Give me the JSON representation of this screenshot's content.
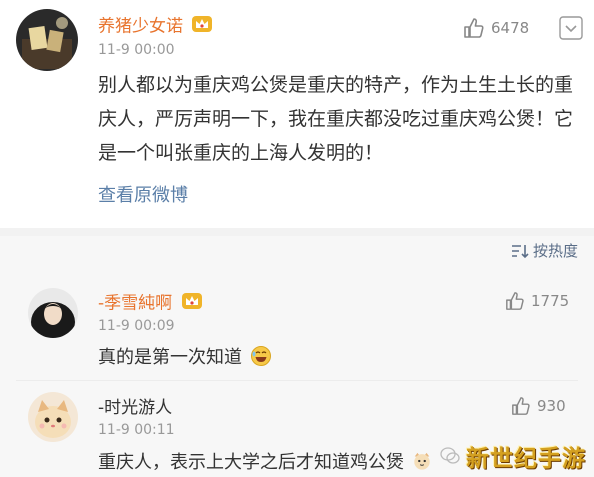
{
  "post": {
    "username": "养猪少女诺",
    "timestamp": "11-9 00:00",
    "likes": "6478",
    "text": "别人都以为重庆鸡公煲是重庆的特产，作为土生土长的重庆人，严厉声明一下，我在重庆都没吃过重庆鸡公煲！它是一个叫张重庆的上海人发明的！",
    "view_original": "查看原微博",
    "username_color": "#e8742e"
  },
  "sort": {
    "label": "按热度"
  },
  "comments": [
    {
      "username": "-季雪純啊",
      "timestamp": "11-9 00:09",
      "likes": "1775",
      "text": "真的是第一次知道",
      "emoji": "laughing-face-icon"
    },
    {
      "username": "-时光游人",
      "timestamp": "11-9 00:11",
      "likes": "930",
      "text": "重庆人，表示上大学之后才知道鸡公煲",
      "emoji": "cat-face-icon"
    }
  ],
  "watermark": {
    "text": "新世纪手游"
  },
  "colors": {
    "link": "#5b7fa8",
    "accent_orange": "#e8742e",
    "vip_gold": "#f0b429"
  }
}
